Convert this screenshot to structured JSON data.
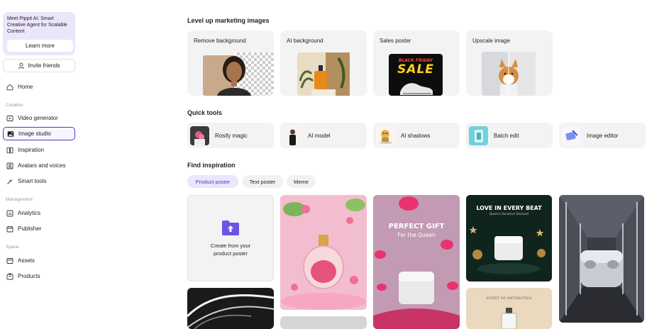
{
  "sidebar": {
    "promo": {
      "title": "Meet Pippit AI: Smart Creative Agent for Scalable Content",
      "button": "Learn more"
    },
    "invite": "Invite friends",
    "home": "Home",
    "sections": {
      "creation": "Creation",
      "management": "Management",
      "space": "Space"
    },
    "items": [
      {
        "label": "Video generator",
        "icon": "video-icon"
      },
      {
        "label": "Image studio",
        "icon": "image-icon",
        "active": true
      },
      {
        "label": "Inspiration",
        "icon": "inspiration-icon"
      },
      {
        "label": "Avatars and voices",
        "icon": "avatar-icon"
      },
      {
        "label": "Smart tools",
        "icon": "tools-icon"
      },
      {
        "label": "Analytics",
        "icon": "analytics-icon"
      },
      {
        "label": "Publisher",
        "icon": "calendar-icon"
      },
      {
        "label": "Assets",
        "icon": "assets-icon"
      },
      {
        "label": "Products",
        "icon": "products-icon"
      }
    ]
  },
  "main": {
    "level_up": {
      "title": "Level up marketing images",
      "cards": [
        "Remove background",
        "AI background",
        "Sales poster",
        "Upscale image"
      ],
      "sale_text_1": "BLACK FRIDAY",
      "sale_text_2": "SALE"
    },
    "quick_tools": {
      "title": "Quick tools",
      "items": [
        "Rosify magic",
        "AI model",
        "AI shadows",
        "Batch edit",
        "Image editor"
      ]
    },
    "inspiration": {
      "title": "Find inspiration",
      "tabs": [
        "Product poster",
        "Text poster",
        "Meme"
      ],
      "active_tab": "Product poster",
      "create_card": "Create from your product poster",
      "poster_gift_title": "PERFECT GIFT",
      "poster_gift_sub": "For the Queen",
      "poster_beat_title": "LOVE IN EVERY BEAT",
      "poster_beat_sub": "Queen's Exclusive Discount",
      "poster_scent": "SCENT OF ANTARCTICA"
    }
  },
  "colors": {
    "accent": "#4a3ad0",
    "promo_bg": "#ece6fb",
    "card_bg": "#f3f3f4"
  }
}
